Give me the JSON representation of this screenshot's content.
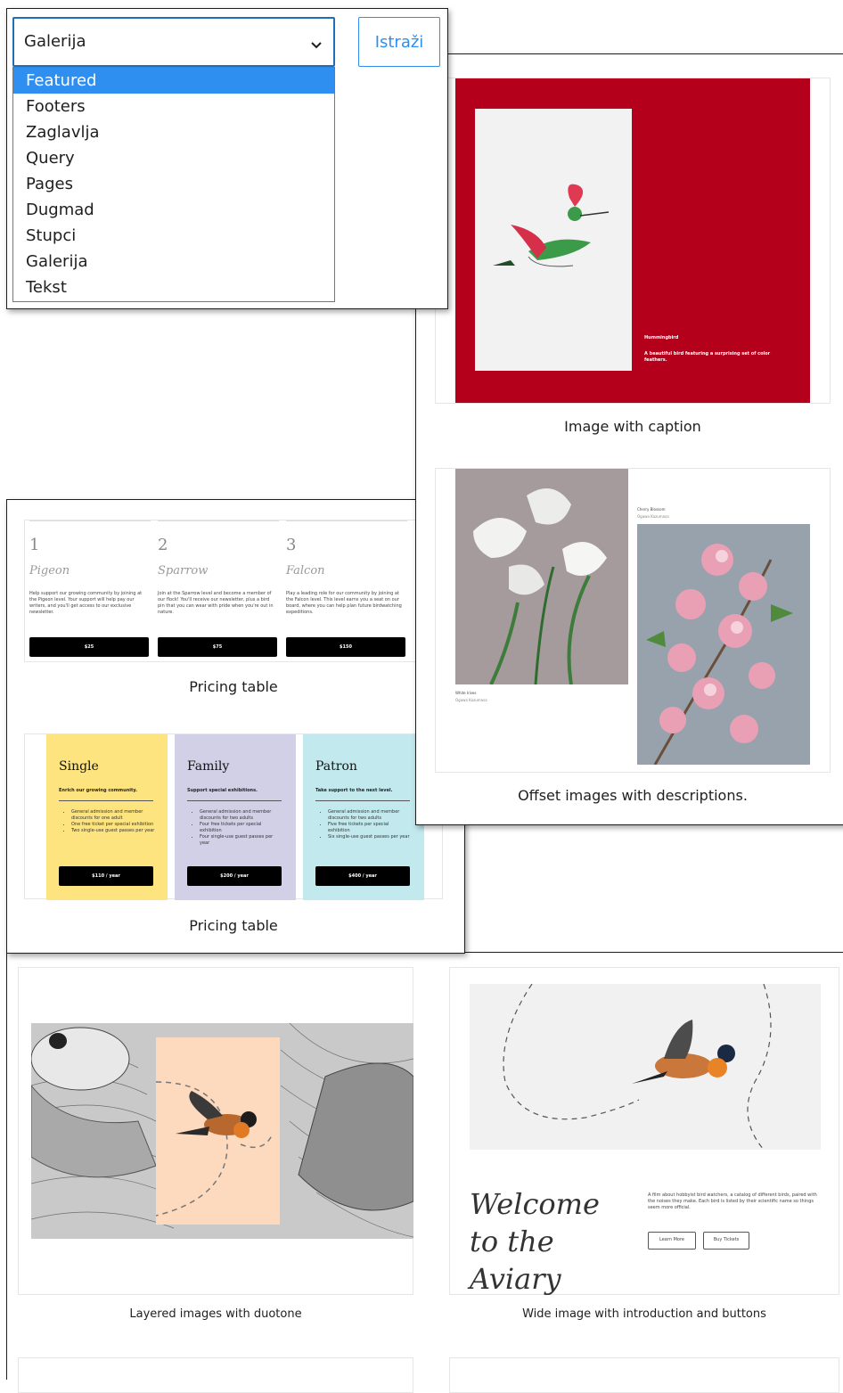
{
  "category_select": {
    "value": "Galerija",
    "options": [
      "Featured",
      "Footers",
      "Zaglavlja",
      "Query",
      "Pages",
      "Dugmad",
      "Stupci",
      "Galerija",
      "Tekst"
    ],
    "highlighted": "Featured"
  },
  "explore_button": "Istraži",
  "patterns": {
    "image_with_caption": {
      "label": "Image with caption",
      "bird_title": "Hummingbird",
      "bird_desc": "A beautiful bird featuring a surprising set of color feathers."
    },
    "offset_images": {
      "label": "Offset images with descriptions.",
      "top_title": "Cherry Blossom",
      "top_sub": "Ogawa Kazumasa",
      "bottom_title": "White Irises",
      "bottom_sub": "Ogawa Kazumasa"
    },
    "pricing_table_1": {
      "label": "Pricing table",
      "tiers": [
        {
          "num": "1",
          "name": "Pigeon",
          "desc": "Help support our growing community by joining at the Pigeon level. Your support will help pay our writers, and you'll get access to our exclusive newsletter.",
          "price": "$25"
        },
        {
          "num": "2",
          "name": "Sparrow",
          "desc": "Join at the Sparrow level and become a member of our flock! You'll receive our newsletter, plus a bird pin that you can wear with pride when you're out in nature.",
          "price": "$75"
        },
        {
          "num": "3",
          "name": "Falcon",
          "desc": "Play a leading role for our community by joining at the Falcon level. This level earns you a seat on our board, where you can help plan future birdwatching expeditions.",
          "price": "$150"
        }
      ]
    },
    "pricing_table_2": {
      "label": "Pricing table",
      "tiers": [
        {
          "name": "Single",
          "tag": "Enrich our growing community.",
          "items": [
            "General admission and member discounts for one adult",
            "One free ticket per special exhibition",
            "Two single-use guest passes per year"
          ],
          "price": "$110 / year",
          "color": "#fde47f"
        },
        {
          "name": "Family",
          "tag": "Support special exhibitions.",
          "items": [
            "General admission and member discounts for two adults",
            "Four free tickets per special exhibition",
            "Four single-use guest passes per year"
          ],
          "price": "$200 / year",
          "color": "#d1d0e6"
        },
        {
          "name": "Patron",
          "tag": "Take support to the next level.",
          "items": [
            "General admission and member discounts for two adults",
            "Five free tickets per special exhibition",
            "Six single-use guest passes per year"
          ],
          "price": "$400 / year",
          "color": "#c2eaee"
        }
      ]
    },
    "layered_images": {
      "label": "Layered images with duotone"
    },
    "wide_image": {
      "label": "Wide image with introduction and buttons",
      "heading": "Welcome to the Aviary",
      "body": "A film about hobbyist bird watchers, a catalog of different birds, paired with the noises they make. Each bird is listed by their scientific name so things seem more official.",
      "btn_learn": "Learn More",
      "btn_tickets": "Buy Tickets"
    }
  },
  "colors": {
    "accent": "#2f8ff0",
    "select_border": "#1e6fb8",
    "crimson": "#b5001c",
    "peach": "#fdd9bd"
  }
}
